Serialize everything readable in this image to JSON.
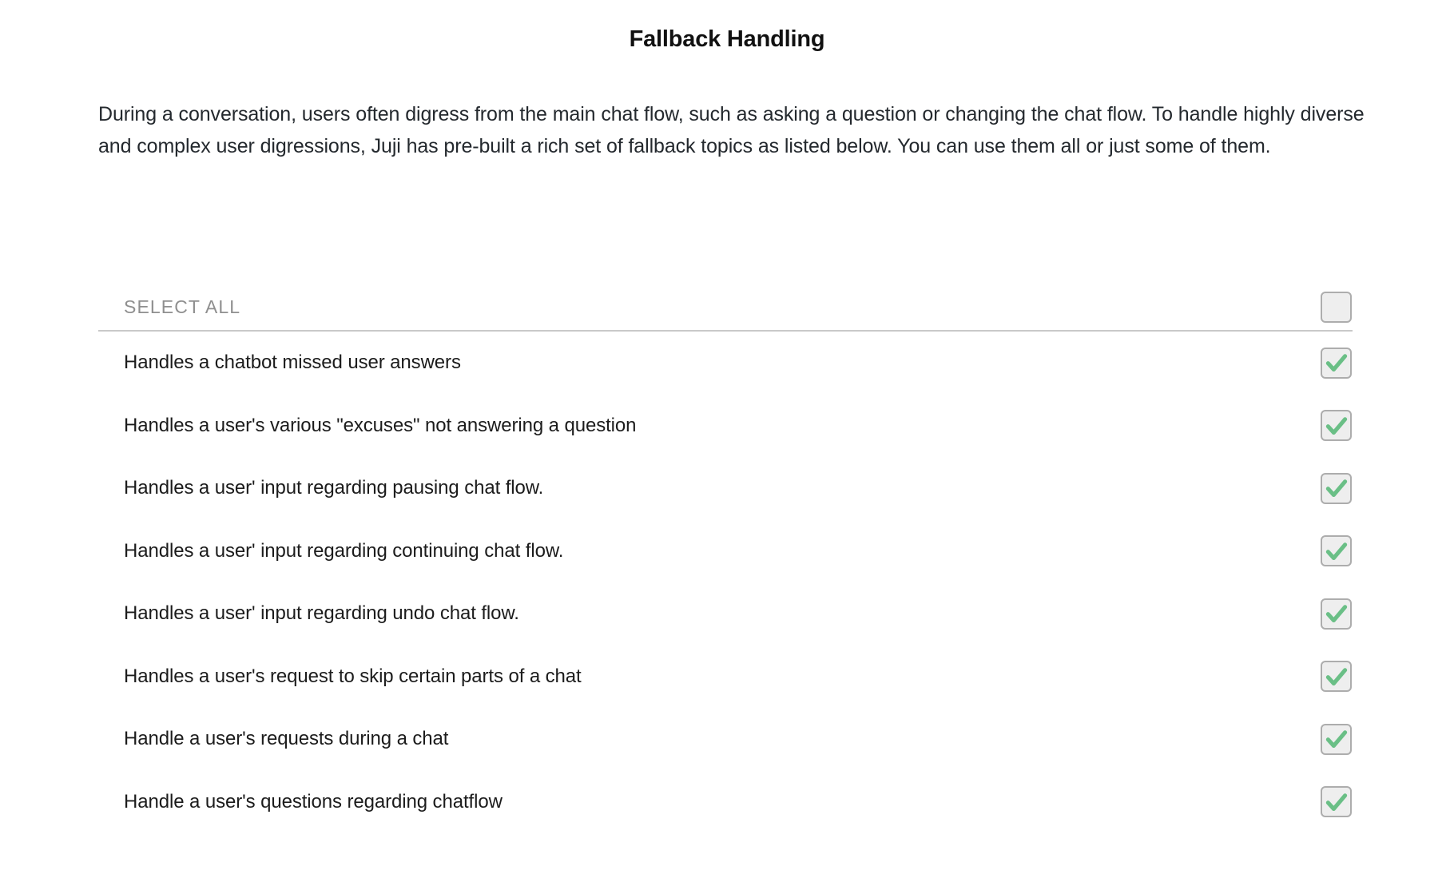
{
  "page": {
    "title": "Fallback Handling",
    "intro": "During a conversation, users often digress from the main chat flow, such as asking a question or changing the chat flow. To handle highly diverse and complex user digressions, Juji has pre-built a rich set of fallback topics as listed below. You can use them all or just some of them."
  },
  "colors": {
    "check_green": "#6abf86",
    "checkbox_border": "#adadad",
    "checkbox_fill": "#eeeeee",
    "divider": "#c9c9c9",
    "label_gray": "#8f8f8f",
    "text": "#1c1c1c",
    "background": "#ffffff"
  },
  "list": {
    "header_label": "SELECT ALL",
    "header_checkbox": {
      "icon": "checkbox-empty-icon",
      "checked": false
    },
    "rows": [
      {
        "label": "Handles a chatbot missed user answers",
        "checked": true,
        "icon": "checkbox-checked-icon"
      },
      {
        "label": "Handles a user's various \"excuses\" not answering a question",
        "checked": true,
        "icon": "checkbox-checked-icon"
      },
      {
        "label": "Handles a user' input regarding pausing chat flow.",
        "checked": true,
        "icon": "checkbox-checked-icon"
      },
      {
        "label": "Handles a user' input regarding continuing chat flow.",
        "checked": true,
        "icon": "checkbox-checked-icon"
      },
      {
        "label": "Handles a user' input regarding undo chat flow.",
        "checked": true,
        "icon": "checkbox-checked-icon"
      },
      {
        "label": "Handles a user's request to skip certain parts of a chat",
        "checked": true,
        "icon": "checkbox-checked-icon"
      },
      {
        "label": "Handle a user's requests during a chat",
        "checked": true,
        "icon": "checkbox-checked-icon"
      },
      {
        "label": "Handle a user's questions regarding chatflow",
        "checked": true,
        "icon": "checkbox-checked-icon"
      }
    ]
  }
}
